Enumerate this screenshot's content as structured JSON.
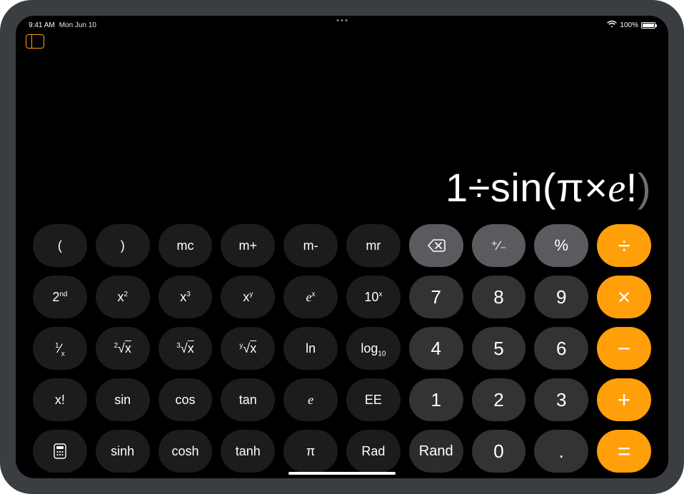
{
  "status": {
    "time": "9:41 AM",
    "date": "Mon Jun 10",
    "battery_pct": "100%"
  },
  "display": {
    "p1": "1÷sin(π×",
    "e": "e",
    "bang": "!",
    "close": ")"
  },
  "keys": {
    "r0": {
      "lparen": "(",
      "rparen": ")",
      "mc": "mc",
      "mplus": "m+",
      "mminus": "m-",
      "mr": "mr",
      "plusminus": "⁺∕₋",
      "percent": "%",
      "divide": "÷"
    },
    "r1": {
      "second": "2",
      "second_sup": "nd",
      "x2_base": "x",
      "x2_sup": "2",
      "x3_base": "x",
      "x3_sup": "3",
      "xy_base": "x",
      "xy_sup": "y",
      "ex_base": "e",
      "ex_sup": "x",
      "tenx_base": "10",
      "tenx_sup": "x",
      "d7": "7",
      "d8": "8",
      "d9": "9",
      "multiply": "×"
    },
    "r2": {
      "recip_n": "1",
      "recip_d": "x",
      "root2_idx": "2",
      "root2_rad": "x",
      "root3_idx": "3",
      "root3_rad": "x",
      "rooty_idx": "y",
      "rooty_rad": "x",
      "ln": "ln",
      "log10_base": "log",
      "log10_sub": "10",
      "d4": "4",
      "d5": "5",
      "d6": "6",
      "minus": "−"
    },
    "r3": {
      "fact": "x!",
      "sin": "sin",
      "cos": "cos",
      "tan": "tan",
      "e": "e",
      "ee": "EE",
      "d1": "1",
      "d2": "2",
      "d3": "3",
      "plus": "+"
    },
    "r4": {
      "sinh": "sinh",
      "cosh": "cosh",
      "tanh": "tanh",
      "pi": "π",
      "rad": "Rad",
      "rand": "Rand",
      "d0": "0",
      "dot": ".",
      "equals": "="
    }
  }
}
